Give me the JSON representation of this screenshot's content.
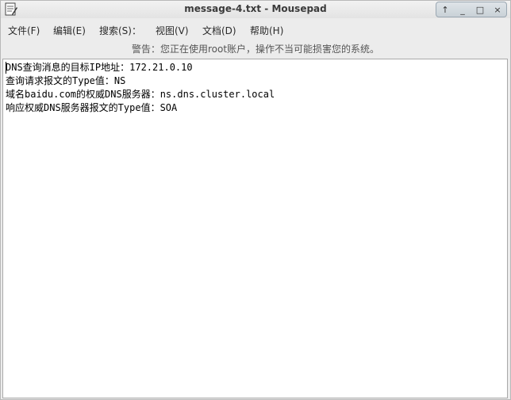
{
  "window": {
    "title": "message-4.txt - Mousepad",
    "controls": [
      "↑",
      "_",
      "□",
      "×"
    ]
  },
  "menubar": {
    "items": [
      {
        "label": "文件(F)"
      },
      {
        "label": "编辑(E)"
      },
      {
        "label": "搜索(S)："
      },
      {
        "label": "视图(V)"
      },
      {
        "label": "文档(D)"
      },
      {
        "label": "帮助(H)"
      }
    ]
  },
  "warning": {
    "text": "警告：您正在使用root账户，操作不当可能损害您的系统。"
  },
  "editor": {
    "lines": [
      "DNS查询消息的目标IP地址：172.21.0.10",
      "查询请求报文的Type值：NS",
      "域名baidu.com的权威DNS服务器：ns.dns.cluster.local",
      "响应权威DNS服务器报文的Type值：SOA"
    ]
  }
}
